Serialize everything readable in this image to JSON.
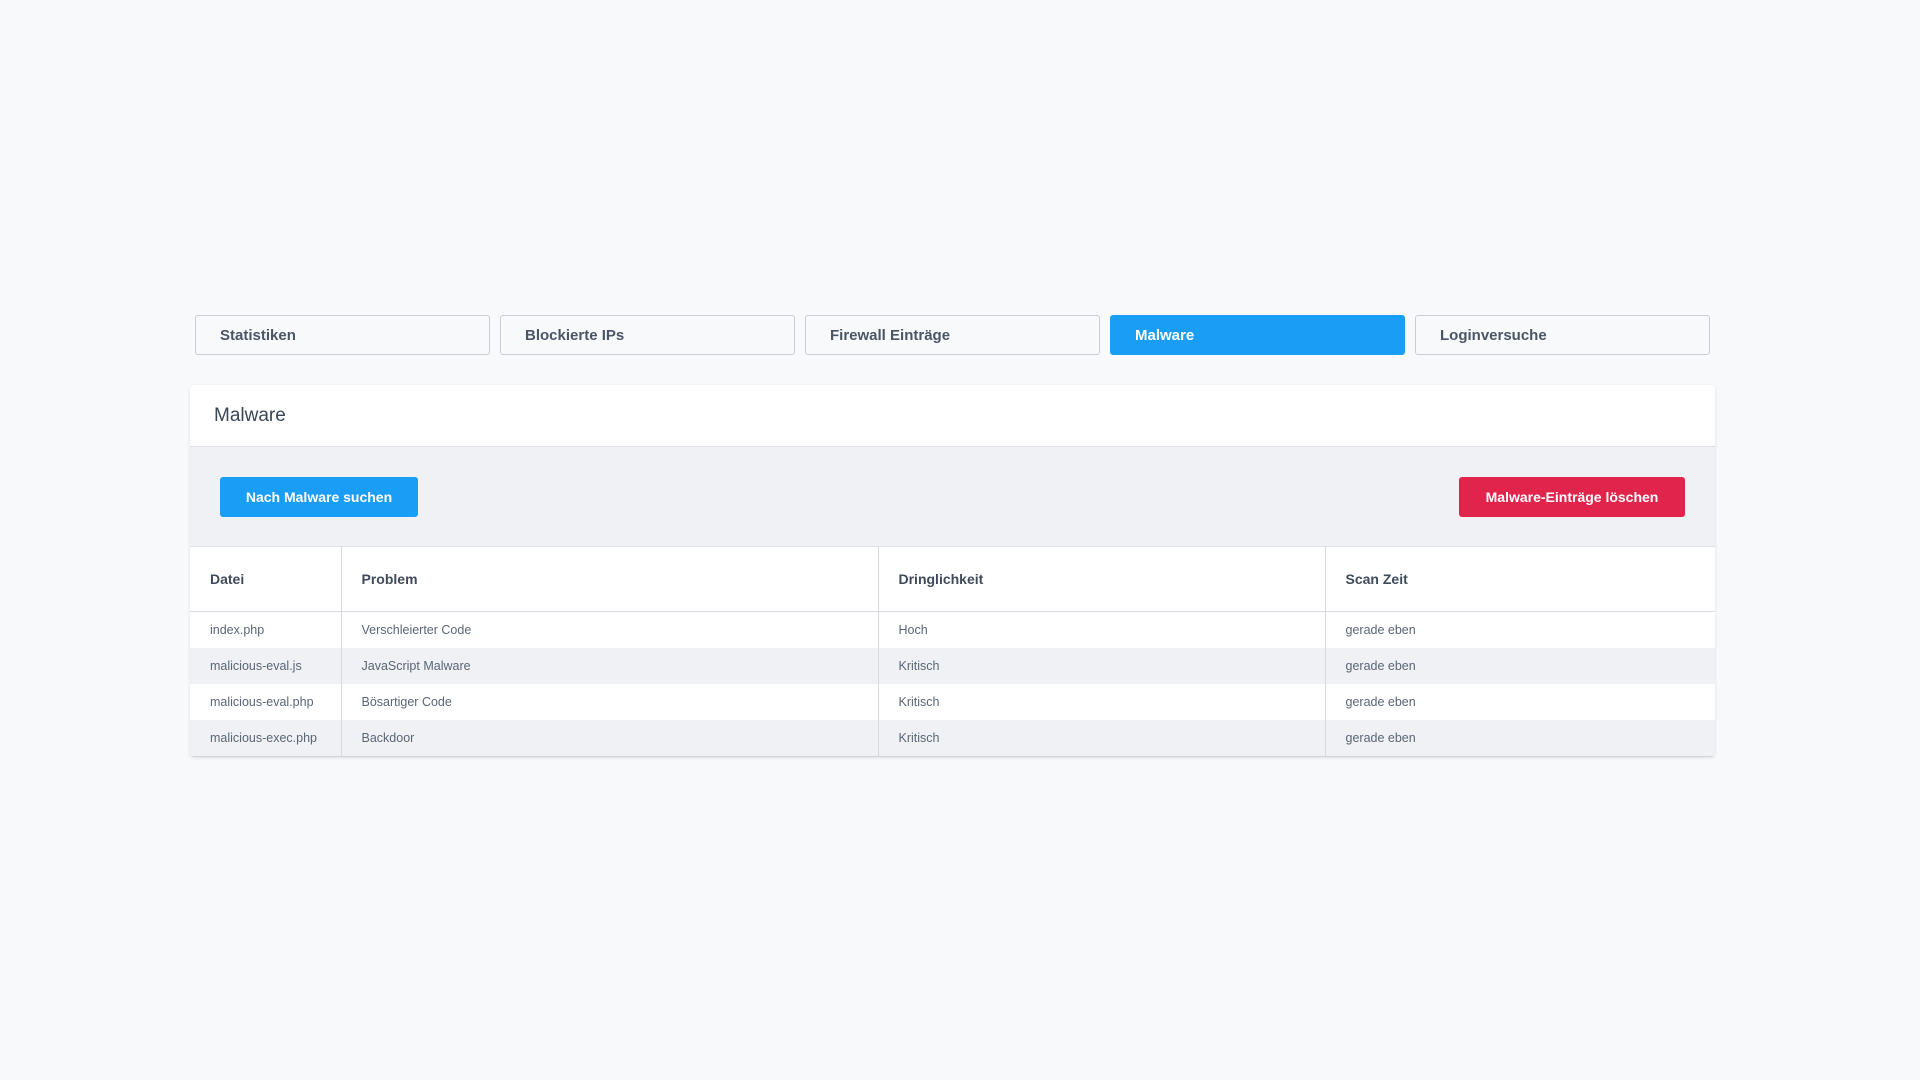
{
  "tabs": [
    {
      "label": "Statistiken",
      "active": false
    },
    {
      "label": "Blockierte IPs",
      "active": false
    },
    {
      "label": "Firewall Einträge",
      "active": false
    },
    {
      "label": "Malware",
      "active": true
    },
    {
      "label": "Loginversuche",
      "active": false
    }
  ],
  "card": {
    "title": "Malware",
    "scan_button": "Nach Malware suchen",
    "delete_button": "Malware-Einträge löschen"
  },
  "table": {
    "columns": [
      "Datei",
      "Problem",
      "Dringlichkeit",
      "Scan Zeit"
    ],
    "rows": [
      {
        "file": "index.php",
        "problem": "Verschleierter Code",
        "severity": "Hoch",
        "time": "gerade eben"
      },
      {
        "file": "malicious-eval.js",
        "problem": "JavaScript Malware",
        "severity": "Kritisch",
        "time": "gerade eben"
      },
      {
        "file": "malicious-eval.php",
        "problem": "Bösartiger Code",
        "severity": "Kritisch",
        "time": "gerade eben"
      },
      {
        "file": "malicious-exec.php",
        "problem": "Backdoor",
        "severity": "Kritisch",
        "time": "gerade eben"
      }
    ]
  },
  "colors": {
    "accent": "#1a9ef5",
    "danger": "#e0244c",
    "background": "#f8f9fb"
  }
}
